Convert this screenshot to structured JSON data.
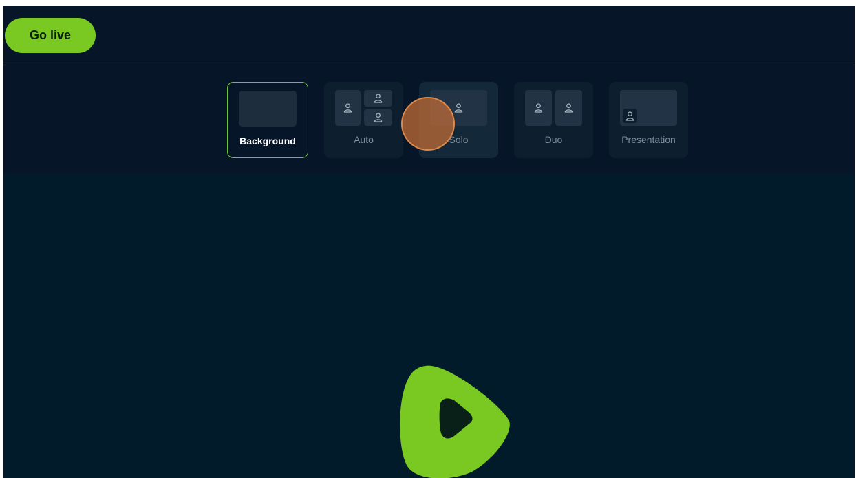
{
  "header": {
    "go_live_label": "Go live"
  },
  "layouts": {
    "selected": "Background",
    "items": [
      {
        "label": "Background",
        "state": "selected"
      },
      {
        "label": "Auto",
        "state": "default"
      },
      {
        "label": "Solo",
        "state": "hover"
      },
      {
        "label": "Duo",
        "state": "default"
      },
      {
        "label": "Presentation",
        "state": "default"
      }
    ]
  },
  "icons": {
    "person": "person-icon",
    "play_logo": "play-logo-icon"
  },
  "colors": {
    "accent": "#79c922",
    "selected_border": "#6bc235",
    "header_bg": "#061628",
    "stage_bg": "#011b2b",
    "card_bg": "#0d1f2f",
    "cursor": "#e08a4a"
  }
}
